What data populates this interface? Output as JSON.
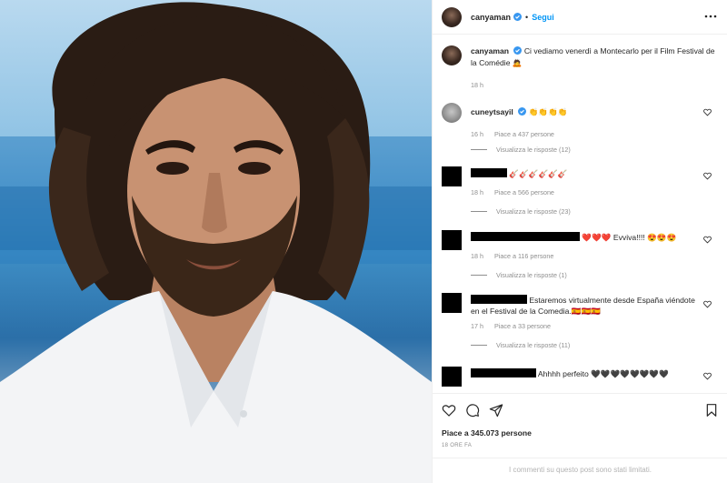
{
  "post": {
    "author": "canyaman",
    "follow_label": "Segui",
    "caption_text": "Ci vediamo venerdì a Montecarlo per il Film Festival de la Comédie 🙇",
    "caption_time": "18 h",
    "likes_text": "Piace a 345.073 persone",
    "post_time": "18 ORE FA",
    "comments_limited": "I commenti su questo post sono stati limitati."
  },
  "comments": [
    {
      "username": "cuneytsayil",
      "text": "👏👏👏👏",
      "time": "16 h",
      "likes": "Piace a 437 persone",
      "replies": "Visualizza le risposte (12)"
    },
    {
      "username": "",
      "text": "🎸🎸🎸🎸🎸🎸",
      "time": "18 h",
      "likes": "Piace a 566 persone",
      "replies": "Visualizza le risposte (23)"
    },
    {
      "username": "",
      "text": "❤️❤️❤️ Evviva!!!! 😍😍😍",
      "time": "18 h",
      "likes": "Piace a 116 persone",
      "replies": "Visualizza le risposte (1)"
    },
    {
      "username": "",
      "text": "Estaremos virtualmente desde España viéndote en el Festival de la Comedia.🇪🇦🇪🇦🇪🇦",
      "time": "17 h",
      "likes": "Piace a 33 persone",
      "replies": "Visualizza le risposte (11)"
    },
    {
      "username": "",
      "text": "Ahhhh perfeito 🖤🖤🖤🖤🖤🖤🖤🖤",
      "time": "",
      "likes": "",
      "replies": ""
    }
  ],
  "colors": {
    "accent": "#0095f6",
    "verified": "#3897f0",
    "meta_text": "#8e8e8e",
    "border": "#efefef"
  },
  "icons": {
    "more": "more-options-icon",
    "verified": "verified-badge-icon",
    "like": "heart-icon",
    "comment": "comment-icon",
    "share": "paper-plane-icon",
    "save": "bookmark-icon"
  }
}
